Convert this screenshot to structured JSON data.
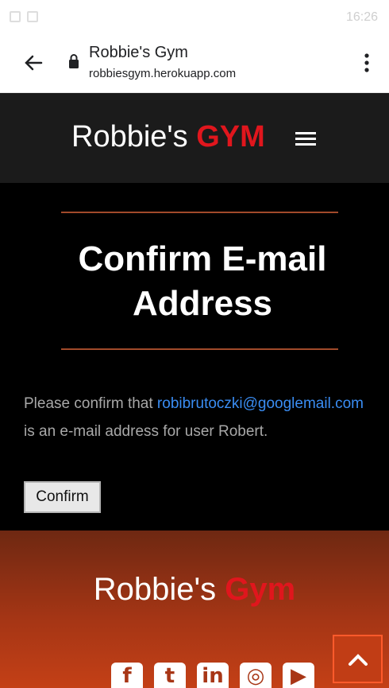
{
  "status_bar": {
    "time": "16:26"
  },
  "browser": {
    "title": "Robbie's Gym",
    "url": "robbiesgym.herokuapp.com"
  },
  "header": {
    "brand_prefix": "Robbie's ",
    "brand_accent": "GYM"
  },
  "main": {
    "title": "Confirm E-mail Address",
    "text_before": "Please confirm that ",
    "email": "robibrutoczki@googlemail.com",
    "text_after": " is an e-mail address for user Robert.",
    "confirm_label": "Confirm"
  },
  "footer": {
    "brand_prefix": "Robbie's ",
    "brand_accent": "Gym",
    "social": [
      "facebook-icon",
      "twitter-icon",
      "linkedin-icon",
      "instagram-icon",
      "youtube-icon"
    ]
  },
  "colors": {
    "accent_red": "#e0161d",
    "link_blue": "#3a8df3",
    "footer_orange": "#c44016"
  }
}
